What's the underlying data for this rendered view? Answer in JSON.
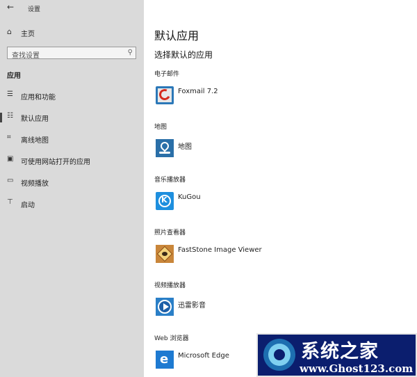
{
  "window": {
    "title": "设置"
  },
  "sidebar": {
    "home_label": "主页",
    "search_placeholder": "查找设置",
    "section_label": "应用",
    "items": [
      {
        "label": "应用和功能",
        "icon": "apps-list-icon"
      },
      {
        "label": "默认应用",
        "icon": "default-apps-icon",
        "selected": true
      },
      {
        "label": "离线地图",
        "icon": "offline-maps-icon"
      },
      {
        "label": "可使用网站打开的应用",
        "icon": "apps-for-websites-icon"
      },
      {
        "label": "视频播放",
        "icon": "video-playback-icon"
      },
      {
        "label": "启动",
        "icon": "startup-icon"
      }
    ]
  },
  "main": {
    "title": "默认应用",
    "subtitle": "选择默认的应用",
    "categories": [
      {
        "label": "电子邮件",
        "app": "Foxmail 7.2",
        "icon": "foxmail-icon"
      },
      {
        "label": "地图",
        "app": "地图",
        "icon": "maps-icon"
      },
      {
        "label": "音乐播放器",
        "app": "KuGou",
        "icon": "kugou-icon"
      },
      {
        "label": "照片查看器",
        "app": "FastStone Image Viewer",
        "icon": "faststone-icon"
      },
      {
        "label": "视频播放器",
        "app": "迅雷影音",
        "icon": "xunlei-player-icon"
      },
      {
        "label": "Web 浏览器",
        "app": "Microsoft Edge",
        "icon": "edge-icon"
      }
    ]
  },
  "watermark": {
    "title": "系统之家",
    "url": "www.Ghost123.com"
  },
  "colors": {
    "sidebar_bg": "#dadada",
    "main_bg": "#ffffff",
    "watermark_bg": "#0b1e6e"
  }
}
